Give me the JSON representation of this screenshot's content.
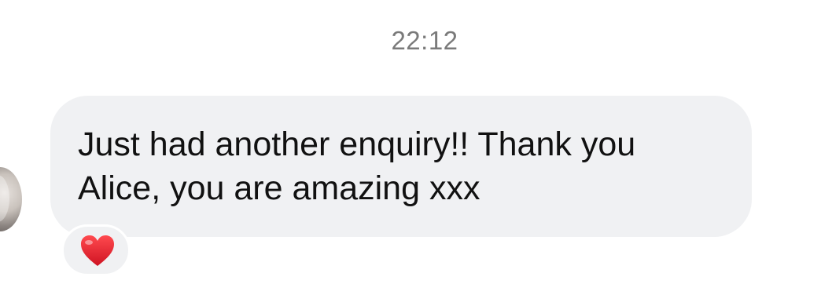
{
  "timestamp": "22:12",
  "message": {
    "sender": "incoming",
    "text_line1": "Just had another enquiry!! Thank you",
    "text_line2": "Alice, you are amazing xxx",
    "bubble_color": "#f0f1f3",
    "text_color": "#111111"
  },
  "reaction": {
    "icon": "red-heart-icon",
    "color": "#e0242f"
  },
  "avatar": {
    "icon": "avatar"
  }
}
